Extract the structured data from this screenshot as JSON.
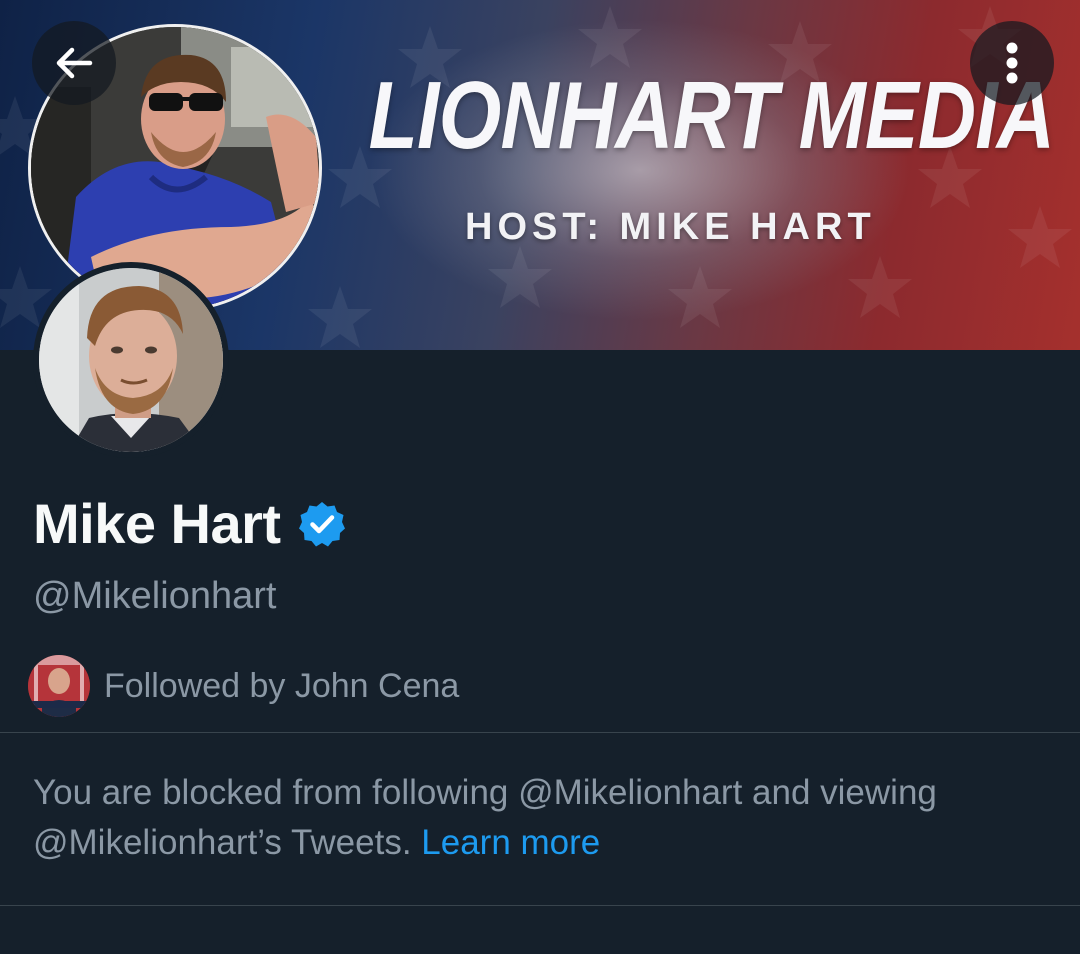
{
  "banner": {
    "title": "LIONHART MEDIA",
    "subtitle": "HOST: MIKE HART"
  },
  "navigation": {
    "back_icon": "arrow-left-icon",
    "more_icon": "more-vertical-icon"
  },
  "profile": {
    "display_name": "Mike Hart",
    "verified": true,
    "verified_icon": "verified-badge-icon",
    "handle": "@Mikelionhart",
    "followed_by_text": "Followed by John Cena"
  },
  "blocked_notice": {
    "text": "You are blocked from following @Mikelionhart and viewing @Mikelionhart’s Tweets.",
    "link_label": "Learn more"
  },
  "colors": {
    "background": "#15202b",
    "primary_text": "#f7f9f9",
    "secondary_text": "#8b98a5",
    "link": "#1d9bf0",
    "divider": "#38444d",
    "verified_badge": "#1d9bf0"
  }
}
